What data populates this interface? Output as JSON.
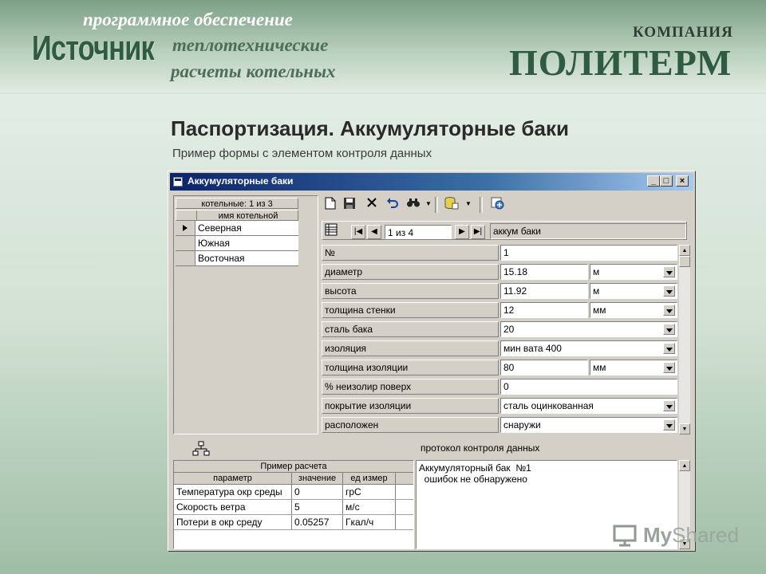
{
  "slide": {
    "tagline_1": "программное обеспечение",
    "tagline_2": "теплотехнические",
    "tagline_3": "расчеты котельных",
    "logo_text": "Источник",
    "company_small": "КОМПАНИЯ",
    "company_large": "ПОЛИТЕРМ",
    "title": "Паспортизация. Аккумуляторные баки",
    "subtitle": "Пример формы с элементом контроля данных"
  },
  "window": {
    "title": "Аккумуляторные баки",
    "buttons": {
      "minimize": "_",
      "maximize": "□",
      "close": "×"
    }
  },
  "boilers_grid": {
    "header": "котельные: 1 из 3",
    "column": "имя котельной",
    "rows": [
      {
        "name": "Северная",
        "current": true
      },
      {
        "name": "Южная",
        "current": false
      },
      {
        "name": "Восточная",
        "current": false
      }
    ]
  },
  "toolbar": {
    "icons": [
      "new-icon",
      "save-icon",
      "delete-icon",
      "undo-icon",
      "find-icon",
      "database-icon",
      "report-icon"
    ]
  },
  "navigator": {
    "position": "1 из 4",
    "label": "аккум баки"
  },
  "form": {
    "rows": [
      {
        "label": "№",
        "value": "1",
        "unit": null,
        "dropdown": false
      },
      {
        "label": "диаметр",
        "value": "15.18",
        "unit": "м",
        "dropdown": false
      },
      {
        "label": "высота",
        "value": "11.92",
        "unit": "м",
        "dropdown": false
      },
      {
        "label": "толщина стенки",
        "value": "12",
        "unit": "мм",
        "dropdown": false
      },
      {
        "label": "сталь бака",
        "value": "20",
        "unit": null,
        "dropdown": true
      },
      {
        "label": "изоляция",
        "value": "мин вата 400",
        "unit": null,
        "dropdown": true
      },
      {
        "label": "толщина изоляции",
        "value": "80",
        "unit": "мм",
        "dropdown": false
      },
      {
        "label": "% неизолир поверх",
        "value": "0",
        "unit": null,
        "dropdown": false
      },
      {
        "label": "покрытие изоляции",
        "value": "сталь оцинкованная",
        "unit": null,
        "dropdown": true
      },
      {
        "label": "расположен",
        "value": "снаружи",
        "unit": null,
        "dropdown": true
      }
    ]
  },
  "protocol_label": "протокол контроля данных",
  "calc_grid": {
    "title": "Пример расчета",
    "headers": [
      "параметр",
      "значение",
      "ед измер"
    ],
    "rows": [
      [
        "Температура окр среды",
        "0",
        "грС"
      ],
      [
        "Скорость ветра",
        "5",
        "м/с"
      ],
      [
        "Потери в окр среду",
        "0.05257",
        "Гкал/ч"
      ]
    ]
  },
  "protocol": {
    "lines": [
      "Аккумуляторный бак  №1",
      "  ошибок не обнаружено"
    ]
  },
  "watermark": {
    "text_1": "My",
    "text_2": "Shared"
  }
}
